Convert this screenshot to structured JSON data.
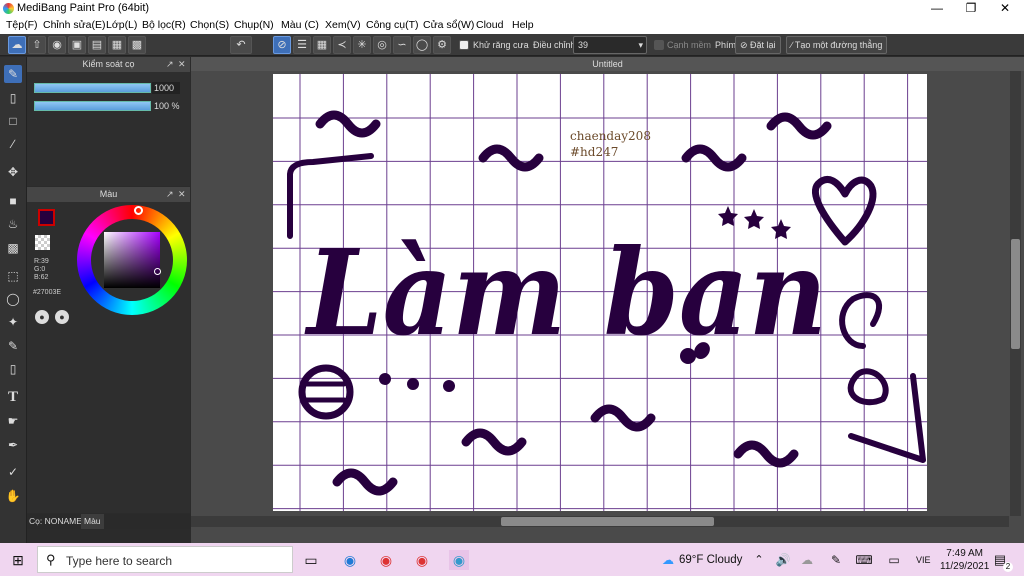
{
  "window": {
    "title": "MediBang Paint Pro (64bit)"
  },
  "menu": [
    "Tệp(F)",
    "Chỉnh sửa(E)",
    "Lớp(L)",
    "Bộ lọc(R)",
    "Chọn(S)",
    "Chụp(N)",
    "Màu (C)",
    "Xem(V)",
    "Công cụ(T)",
    "Cửa sổ(W)",
    "Cloud",
    "Help"
  ],
  "toolbar": {
    "antialias": "Khử răng cưa",
    "adjust_label": "Điều chỉnh",
    "adjust_value": "39",
    "soft_edge": "Cạnh mềm",
    "key_label": "Phím",
    "reset": "Đặt lại",
    "straight_line": "Tạo một đường thẳng"
  },
  "brush_panel": {
    "title": "Kiểm soát cọ",
    "size": "1000",
    "opacity": "100 %"
  },
  "color_panel": {
    "title": "Màu",
    "r": "R:39",
    "g": "G:0",
    "b": "B:62",
    "hex": "#27003E",
    "current_color": "#27003e"
  },
  "bottom_tabs": {
    "brush": "Cọ: NONAME",
    "color": "Màu"
  },
  "document": {
    "tab": "Untitled",
    "watermark_line1": "chaenday208",
    "watermark_line2": "#hd247",
    "main_text": "Làm bạn",
    "ink_color": "#27003e",
    "grid_color": "#6b3f8f"
  },
  "taskbar": {
    "search": "Type here to search",
    "weather": "69°F Cloudy",
    "lang": "VIE",
    "time": "7:49 AM",
    "date": "11/29/2021",
    "notif_count": "2"
  }
}
